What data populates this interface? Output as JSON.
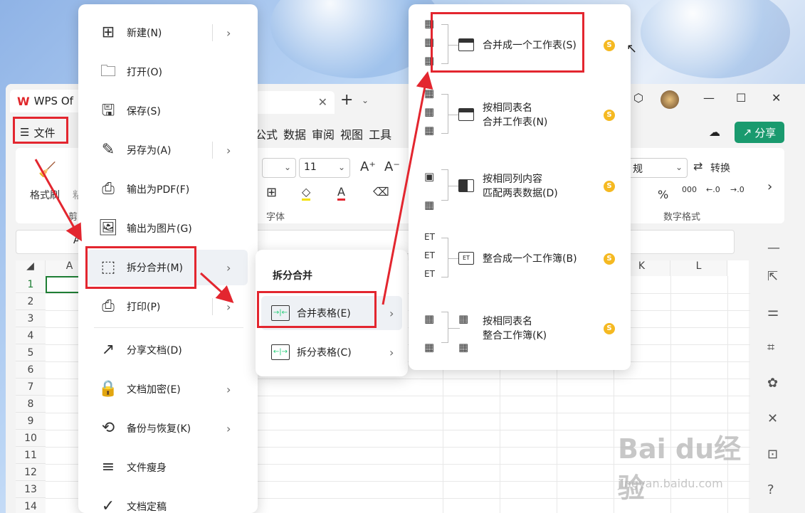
{
  "titlebar": {
    "app_name": "WPS Of",
    "doc_close": "✕",
    "new_tab": "+"
  },
  "menubar": {
    "file_menu": "文件",
    "tabs": [
      "公式",
      "数据",
      "审阅",
      "视图",
      "工具"
    ],
    "share": "分享"
  },
  "ribbon": {
    "format_painter": "格式刷",
    "paste_partial": "粘",
    "clipboard_partial": "剪",
    "font_size": "11",
    "font_group": "字体",
    "number_format_value": "规",
    "convert": "转换",
    "number_group": "数字格式",
    "percent": "%",
    "thousands": "000"
  },
  "formula_bar": {
    "name_box_partial": "A"
  },
  "grid": {
    "columns": [
      "A",
      "K",
      "L"
    ],
    "rows": [
      "1",
      "2",
      "3",
      "4",
      "5",
      "6",
      "7",
      "8",
      "9",
      "10",
      "11",
      "12",
      "13",
      "14"
    ]
  },
  "file_menu": {
    "items": [
      {
        "label": "新建(N)",
        "icon": "new-doc-icon",
        "glyph": "⊞",
        "submenu": true,
        "split": true
      },
      {
        "label": "打开(O)",
        "icon": "folder-open-icon",
        "glyph": "🗀",
        "submenu": false
      },
      {
        "label": "保存(S)",
        "icon": "save-icon",
        "glyph": "🖫",
        "submenu": false
      },
      {
        "label": "另存为(A)",
        "icon": "save-as-icon",
        "glyph": "✎",
        "submenu": true,
        "split": true
      },
      {
        "label": "输出为PDF(F)",
        "icon": "export-pdf-icon",
        "glyph": "⎙",
        "submenu": false
      },
      {
        "label": "输出为图片(G)",
        "icon": "export-image-icon",
        "glyph": "🖼",
        "submenu": false
      },
      {
        "label": "拆分合并(M)",
        "icon": "split-merge-icon",
        "glyph": "⬚",
        "submenu": true,
        "hover": true
      },
      {
        "label": "打印(P)",
        "icon": "print-icon",
        "glyph": "⎙",
        "submenu": true,
        "split": true
      },
      {
        "label": "分享文档(D)",
        "icon": "share-doc-icon",
        "glyph": "↗",
        "submenu": false,
        "divider_before": true
      },
      {
        "label": "文档加密(E)",
        "icon": "encrypt-doc-icon",
        "glyph": "🔒",
        "submenu": true
      },
      {
        "label": "备份与恢复(K)",
        "icon": "backup-restore-icon",
        "glyph": "⟲",
        "submenu": true
      },
      {
        "label": "文件瘦身",
        "icon": "file-slim-icon",
        "glyph": "≡",
        "submenu": false
      },
      {
        "label": "文档定稿",
        "icon": "finalize-doc-icon",
        "glyph": "✓",
        "submenu": false
      }
    ]
  },
  "split_merge_menu": {
    "title": "拆分合并",
    "items": [
      {
        "label": "合并表格(E)",
        "icon": "merge-table-icon",
        "glyph": "→|←"
      },
      {
        "label": "拆分表格(C)",
        "icon": "split-table-icon",
        "glyph": "←|→"
      }
    ]
  },
  "merge_panel": {
    "vip_glyph": "S",
    "items": [
      {
        "line1": "合并成一个工作表(S)",
        "line2": ""
      },
      {
        "line1": "按相同表名",
        "line2": "合并工作表(N)"
      },
      {
        "line1": "按相同列内容",
        "line2": "匹配两表数据(D)"
      },
      {
        "line1": "整合成一个工作簿(B)",
        "line2": ""
      },
      {
        "line1": "按相同表名",
        "line2": "整合工作簿(K)"
      }
    ]
  },
  "watermark": {
    "brand": "Bai du经验",
    "url": "jingyan.baidu.com"
  },
  "colors": {
    "annotation_red": "#e3262f",
    "share_green": "#1a9a6e",
    "active_cell": "#1e7e34",
    "vip_gold": "#f5b921"
  }
}
